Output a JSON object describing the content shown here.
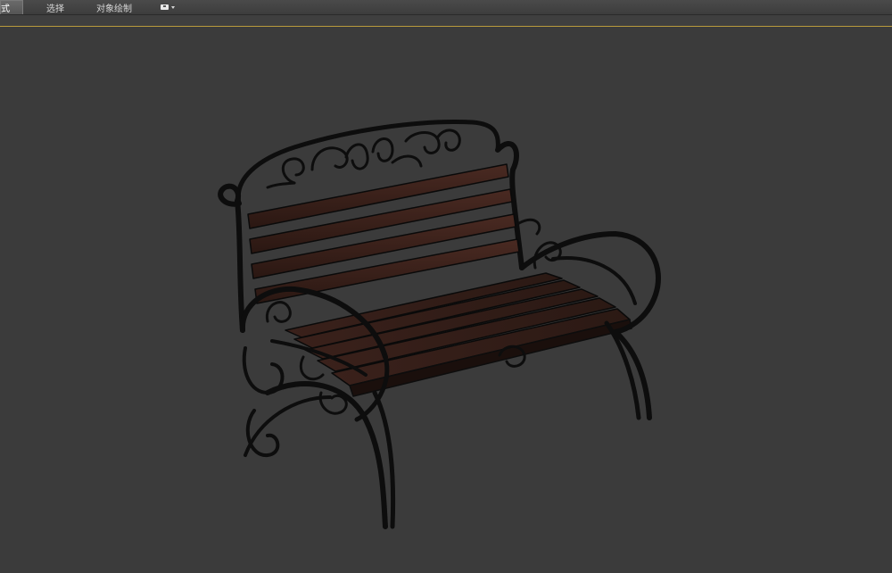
{
  "menubar": {
    "tabs": [
      {
        "label": "式",
        "active": true
      },
      {
        "label": "选择",
        "active": false
      },
      {
        "label": "对象绘制",
        "active": false
      }
    ],
    "icon_dropdown": {
      "icon": "viewport-display-icon"
    }
  },
  "viewport": {
    "background_color": "#3b3b3b",
    "active_border_color": "#b89a3c",
    "object": "park-bench-model"
  }
}
